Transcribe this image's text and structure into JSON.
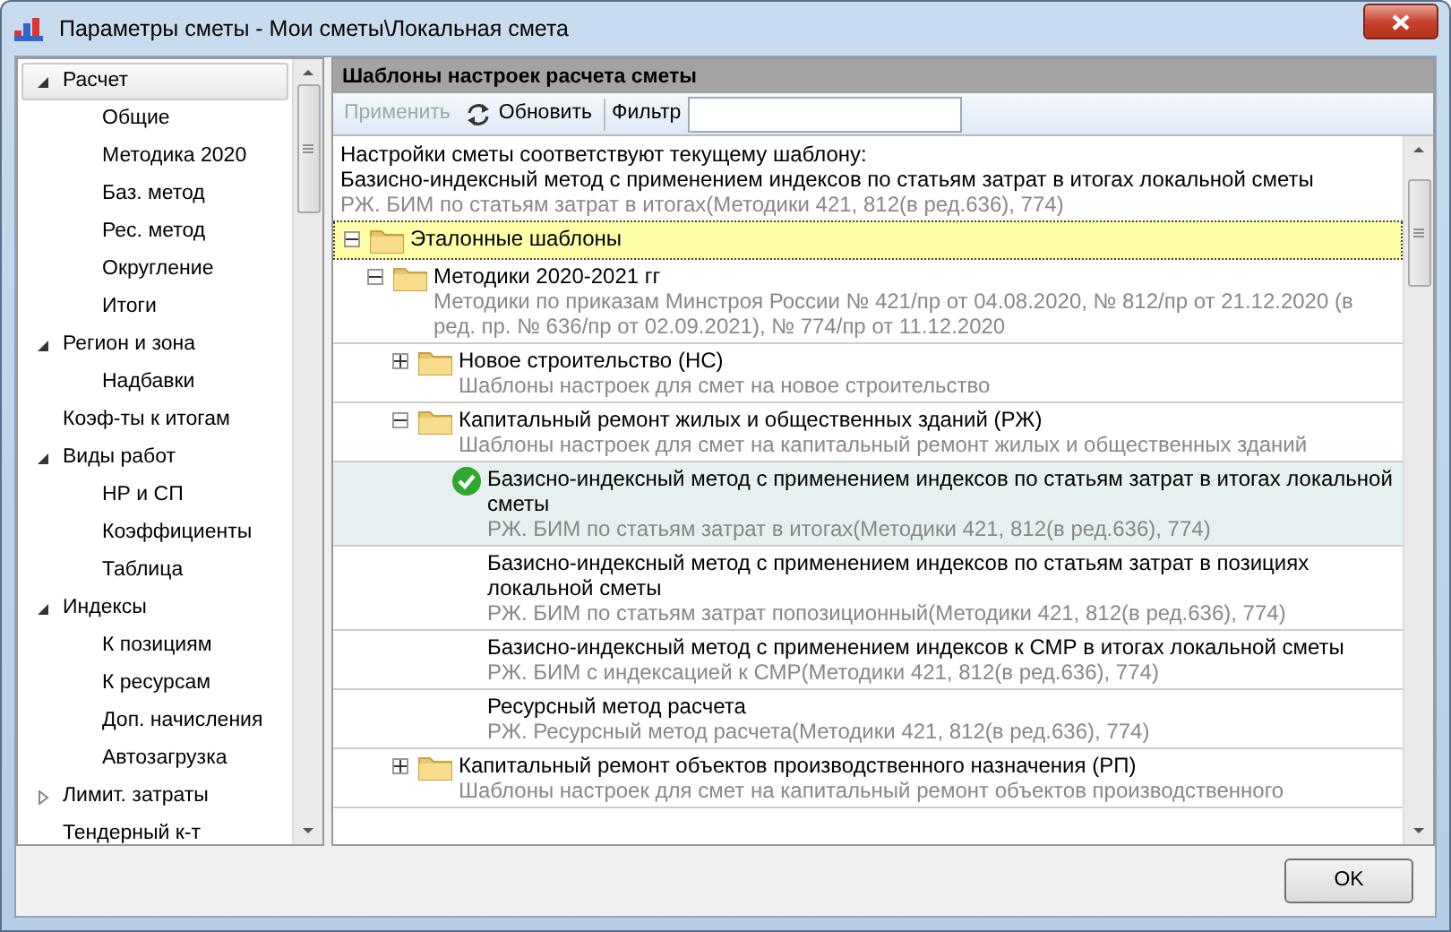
{
  "window": {
    "title": "Параметры сметы - Мои сметы\\Локальная смета"
  },
  "sidebar": {
    "items": [
      {
        "label": "Расчет",
        "kind": "group",
        "expanded": true,
        "selected": true,
        "children": [
          {
            "label": "Общие",
            "kind": "leaf",
            "selected": false
          },
          {
            "label": "Методика 2020",
            "kind": "leaf",
            "selected": false
          },
          {
            "label": "Баз. метод",
            "kind": "leaf",
            "selected": false
          },
          {
            "label": "Рес. метод",
            "kind": "leaf",
            "selected": false
          },
          {
            "label": "Округление",
            "kind": "leaf",
            "selected": false
          },
          {
            "label": "Итоги",
            "kind": "leaf",
            "selected": false
          }
        ]
      },
      {
        "label": "Регион и зона",
        "kind": "group",
        "expanded": true,
        "selected": false,
        "children": [
          {
            "label": "Надбавки",
            "kind": "leaf",
            "selected": false
          }
        ]
      },
      {
        "label": "Коэф-ты к итогам",
        "kind": "leaf",
        "selected": false
      },
      {
        "label": "Виды работ",
        "kind": "group",
        "expanded": true,
        "selected": false,
        "children": [
          {
            "label": "НР и СП",
            "kind": "leaf",
            "selected": false
          },
          {
            "label": "Коэффициенты",
            "kind": "leaf",
            "selected": false
          },
          {
            "label": "Таблица",
            "kind": "leaf",
            "selected": false
          }
        ]
      },
      {
        "label": "Индексы",
        "kind": "group",
        "expanded": true,
        "selected": false,
        "children": [
          {
            "label": "К позициям",
            "kind": "leaf",
            "selected": false
          },
          {
            "label": "К ресурсам",
            "kind": "leaf",
            "selected": false
          },
          {
            "label": "Доп. начисления",
            "kind": "leaf",
            "selected": false
          },
          {
            "label": "Автозагрузка",
            "kind": "leaf",
            "selected": false
          }
        ]
      },
      {
        "label": "Лимит. затраты",
        "kind": "group",
        "expanded": false,
        "selected": false
      },
      {
        "label": "Тендерный к-т",
        "kind": "leaf",
        "selected": false
      }
    ]
  },
  "panel": {
    "title": "Шаблоны настроек расчета сметы",
    "toolbar": {
      "apply": {
        "label": "Применить",
        "disabled": true
      },
      "refresh": {
        "label": "Обновить",
        "disabled": false
      },
      "filter": {
        "label": "Фильтр"
      }
    },
    "current": {
      "heading": "Настройки сметы соответствуют текущему шаблону:",
      "name": "Базисно-индексный метод с применением индексов по статьям затрат в итогах локальной сметы",
      "description": "РЖ. БИМ по статьям затрат в итогах(Методики 421, 812(в ред.636), 774)"
    },
    "tree": [
      {
        "kind": "folder",
        "label": "Эталонные шаблоны",
        "expanded": true,
        "selected": true,
        "children": [
          {
            "kind": "folder",
            "label": "Методики 2020-2021 гг",
            "description": "Методики по приказам Минстроя России № 421/пр от 04.08.2020, № 812/пр от 21.12.2020 (в ред. пр. № 636/пр от 02.09.2021), № 774/пр от 11.12.2020",
            "expanded": true,
            "selected": false,
            "children": [
              {
                "kind": "folder",
                "label": "Новое строительство (НС)",
                "description": "Шаблоны настроек для смет на новое строительство",
                "expanded": false,
                "selected": false
              },
              {
                "kind": "folder",
                "label": "Капитальный ремонт жилых и общественных зданий (РЖ)",
                "description": "Шаблоны настроек для смет на капитальный ремонт жилых и общественных зданий",
                "expanded": true,
                "selected": false,
                "children": [
                  {
                    "kind": "template",
                    "label": "Базисно-индексный метод с применением индексов по статьям затрат в итогах локальной сметы",
                    "description": "РЖ. БИМ по статьям затрат в итогах(Методики 421, 812(в ред.636), 774)",
                    "current": true,
                    "selected": false
                  },
                  {
                    "kind": "template",
                    "label": "Базисно-индексный метод с применением индексов по статьям затрат в позициях локальной сметы",
                    "description": "РЖ. БИМ по статьям затрат попозиционный(Методики 421, 812(в ред.636), 774)",
                    "current": false,
                    "selected": false
                  },
                  {
                    "kind": "template",
                    "label": "Базисно-индексный метод с применением индексов к СМР в итогах локальной сметы",
                    "description": "РЖ. БИМ с индексацией к СМР(Методики 421, 812(в ред.636), 774)",
                    "current": false,
                    "selected": false
                  },
                  {
                    "kind": "template",
                    "label": "Ресурсный метод расчета",
                    "description": "РЖ. Ресурсный метод расчета(Методики 421, 812(в ред.636), 774)",
                    "current": false,
                    "selected": false
                  }
                ]
              },
              {
                "kind": "folder",
                "label": "Капитальный ремонт объектов производственного назначения (РП)",
                "description": "Шаблоны настроек для смет на капитальный ремонт объектов производственного",
                "expanded": false,
                "selected": false
              }
            ]
          }
        ]
      }
    ]
  },
  "buttons": [
    {
      "label": "OK"
    }
  ]
}
